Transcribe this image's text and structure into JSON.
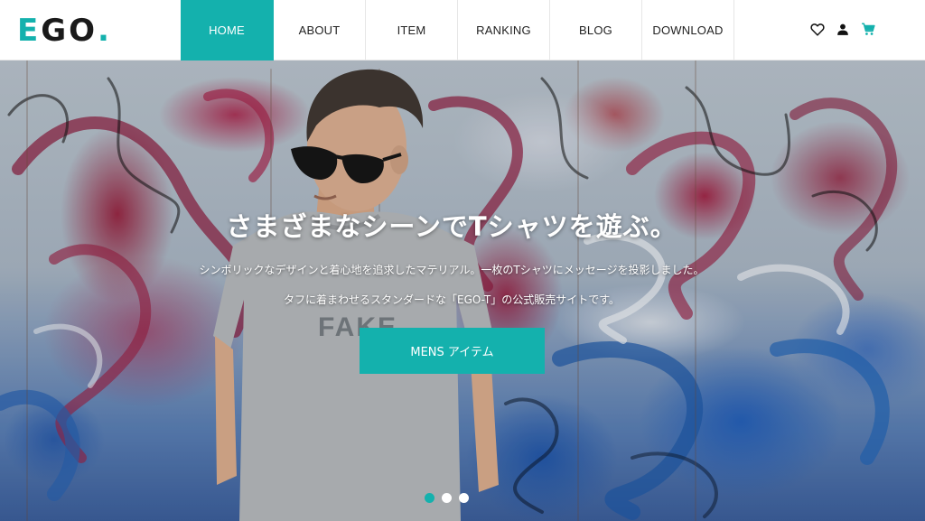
{
  "brand": {
    "logo_text_1": "EGO",
    "logo_dot": ".",
    "accent_color": "#14b1ad"
  },
  "nav": {
    "items": [
      {
        "label": "HOME",
        "active": true
      },
      {
        "label": "ABOUT"
      },
      {
        "label": "ITEM"
      },
      {
        "label": "RANKING"
      },
      {
        "label": "BLOG"
      },
      {
        "label": "DOWNLOAD"
      }
    ]
  },
  "header_icons": [
    "heart-icon",
    "user-icon",
    "cart-icon"
  ],
  "hero": {
    "title": "さまざまなシーンでTシャツを遊ぶ。",
    "description_line_1": "シンボリックなデザインと着心地を追求したマテリアル。一枚のTシャツにメッセージを投影しました。",
    "description_line_2": "タフに着まわせるスタンダードな「EGO-T」の公式販売サイトです。",
    "cta_label": "MENS アイテム",
    "shirt_print": "FAKE",
    "slides": 3,
    "active_slide": 1
  }
}
